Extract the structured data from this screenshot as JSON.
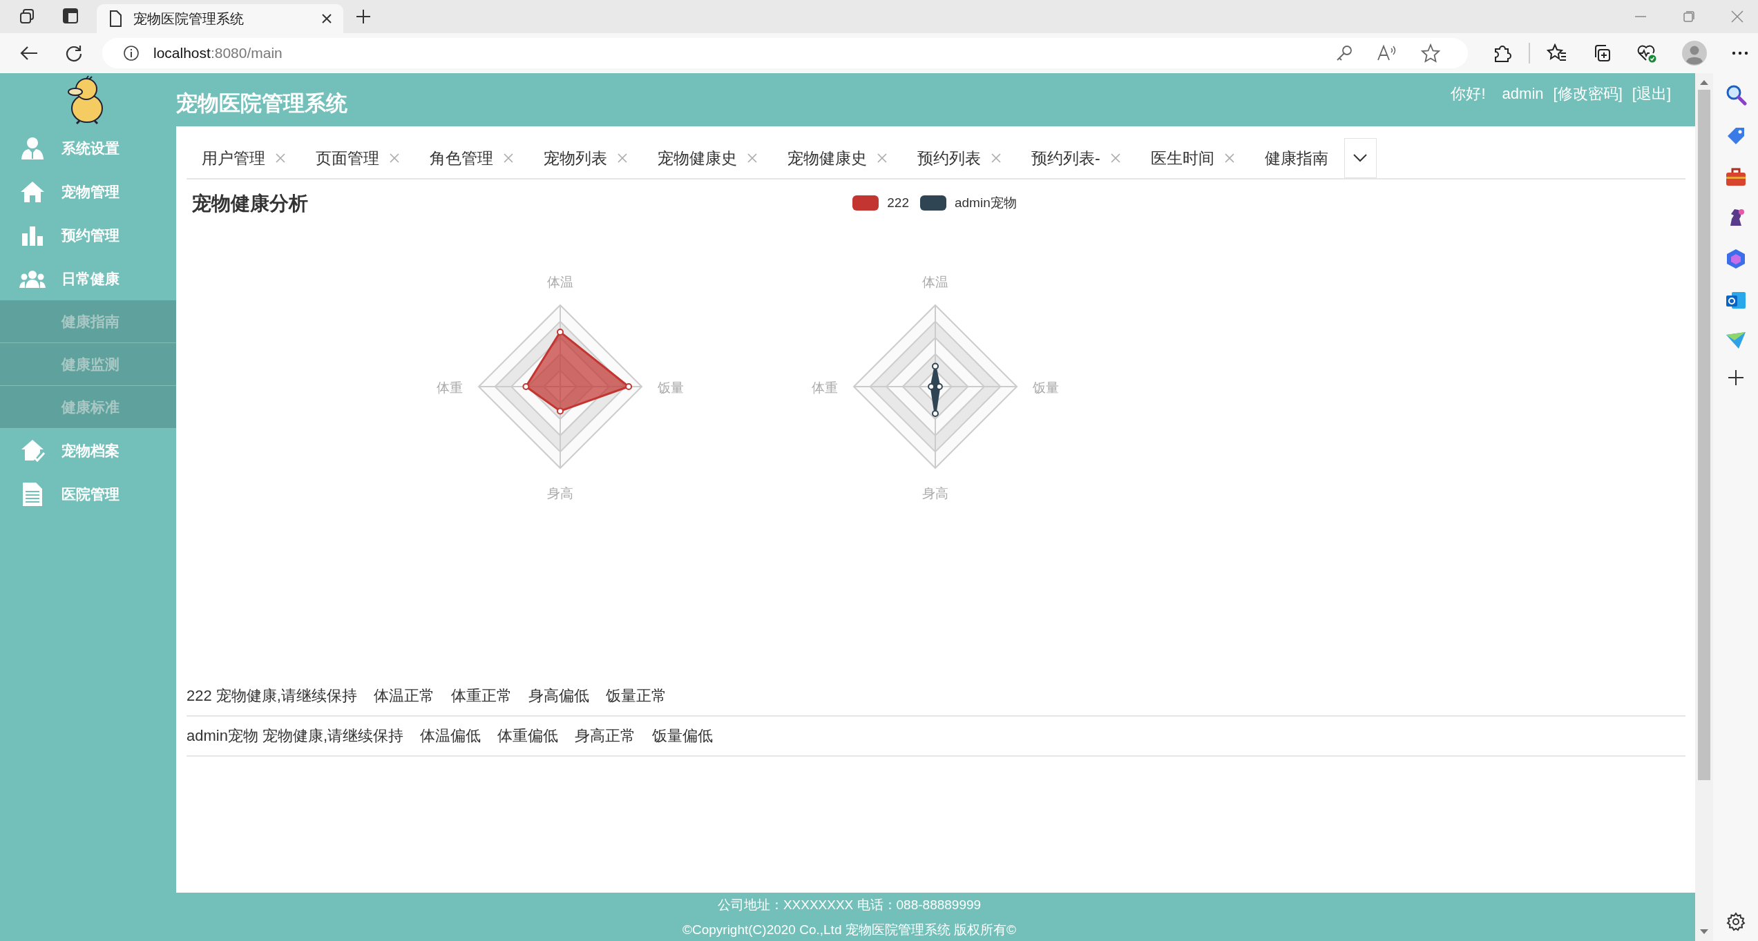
{
  "browser": {
    "tab_title": "宠物医院管理系统",
    "url_host": "localhost",
    "url_rest": ":8080/main"
  },
  "header": {
    "title": "宠物医院管理系统",
    "greeting": "你好!",
    "user": "admin",
    "links": [
      "[修改密码]",
      "[退出]"
    ]
  },
  "sidebar": {
    "items": [
      {
        "label": "系统设置"
      },
      {
        "label": "宠物管理"
      },
      {
        "label": "预约管理"
      },
      {
        "label": "日常健康",
        "children": [
          {
            "label": "健康指南"
          },
          {
            "label": "健康监测"
          },
          {
            "label": "健康标准"
          }
        ]
      },
      {
        "label": "宠物档案"
      },
      {
        "label": "医院管理"
      }
    ]
  },
  "tabs": [
    {
      "label": "用户管理",
      "closable": true
    },
    {
      "label": "页面管理",
      "closable": true
    },
    {
      "label": "角色管理",
      "closable": true
    },
    {
      "label": "宠物列表",
      "closable": true
    },
    {
      "label": "宠物健康史",
      "closable": true
    },
    {
      "label": "宠物健康史",
      "closable": true
    },
    {
      "label": "预约列表",
      "closable": true
    },
    {
      "label": "预约列表-",
      "closable": true
    },
    {
      "label": "医生时间",
      "closable": true
    },
    {
      "label": "健康指南",
      "closable": false
    }
  ],
  "page": {
    "title": "宠物健康分析",
    "legend": [
      {
        "name": "222",
        "color": "#c23531"
      },
      {
        "name": "admin宠物",
        "color": "#2f4554"
      }
    ],
    "radars": [
      {
        "indicators": [
          "体温",
          "饭量",
          "身高",
          "体重"
        ]
      },
      {
        "indicators": [
          "体温",
          "饭量",
          "身高",
          "体重"
        ]
      }
    ]
  },
  "results": [
    {
      "summary": "222 宠物健康,请继续保持",
      "items": [
        "体温正常",
        "体重正常",
        "身高偏低",
        "饭量正常"
      ]
    },
    {
      "summary": "admin宠物 宠物健康,请继续保持",
      "items": [
        "体温偏低",
        "体重偏低",
        "身高正常",
        "饭量偏低"
      ]
    }
  ],
  "footer": {
    "lines": [
      "公司地址：XXXXXXXX 电话：088-88889999",
      "©Copyright(C)2020 Co.,Ltd 宠物医院管理系统 版权所有©"
    ]
  }
}
